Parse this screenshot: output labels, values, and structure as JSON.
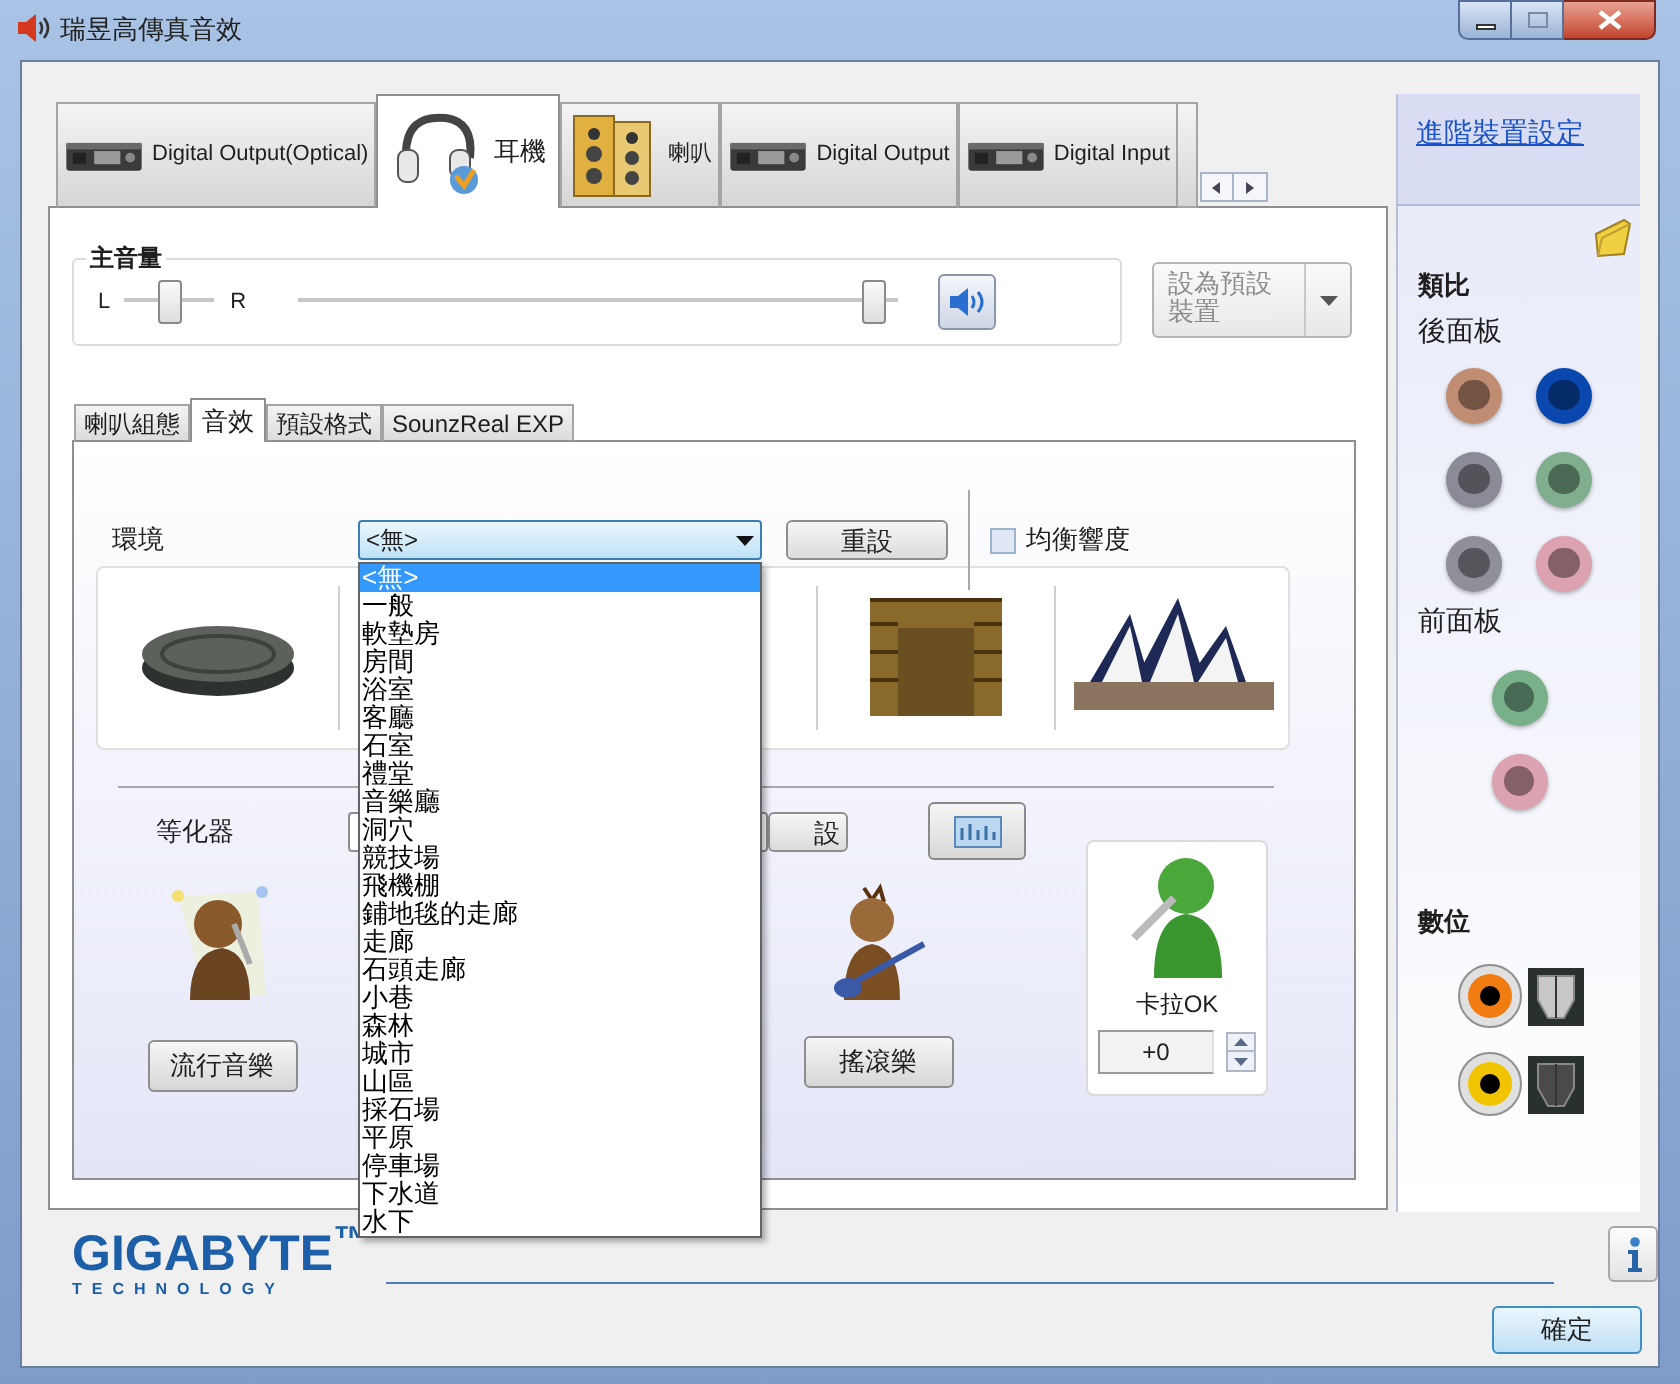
{
  "window": {
    "title": "瑞昱高傳真音效"
  },
  "device_tabs": [
    {
      "label": "Digital Output(Optical)",
      "kind": "digital",
      "selected": false
    },
    {
      "label": "耳機",
      "kind": "headphones",
      "selected": true
    },
    {
      "label": "喇叭",
      "kind": "speakers",
      "selected": false
    },
    {
      "label": "Digital Output",
      "kind": "digital",
      "selected": false
    },
    {
      "label": "Digital Input",
      "kind": "digital",
      "selected": false
    }
  ],
  "master_volume": {
    "label": "主音量",
    "left_label": "L",
    "right_label": "R",
    "balance": {
      "level": 0.5
    },
    "volume": {
      "level": 0.96
    }
  },
  "default_device_button": {
    "label": "設為預設裝置",
    "disabled": true
  },
  "effect_tabs": [
    {
      "label": "喇叭組態",
      "selected": false
    },
    {
      "label": "音效",
      "selected": true
    },
    {
      "label": "預設格式",
      "selected": false
    },
    {
      "label": "SounzReal EXP",
      "selected": false
    }
  ],
  "environment": {
    "label": "環境",
    "value": "<無>",
    "reset_button": "重設",
    "loudness": {
      "label": "均衡響度",
      "checked": false
    },
    "options": [
      {
        "label": "<無>",
        "selected": true
      },
      {
        "label": "一般",
        "selected": false
      },
      {
        "label": "軟墊房",
        "selected": false
      },
      {
        "label": "房間",
        "selected": false
      },
      {
        "label": "浴室",
        "selected": false
      },
      {
        "label": "客廳",
        "selected": false
      },
      {
        "label": "石室",
        "selected": false
      },
      {
        "label": "禮堂",
        "selected": false
      },
      {
        "label": "音樂廳",
        "selected": false
      },
      {
        "label": "洞穴",
        "selected": false
      },
      {
        "label": "競技場",
        "selected": false
      },
      {
        "label": "飛機棚",
        "selected": false
      },
      {
        "label": "鋪地毯的走廊",
        "selected": false
      },
      {
        "label": "走廊",
        "selected": false
      },
      {
        "label": "石頭走廊",
        "selected": false
      },
      {
        "label": "小巷",
        "selected": false
      },
      {
        "label": "森林",
        "selected": false
      },
      {
        "label": "城市",
        "selected": false
      },
      {
        "label": "山區",
        "selected": false
      },
      {
        "label": "採石場",
        "selected": false
      },
      {
        "label": "平原",
        "selected": false
      },
      {
        "label": "停車場",
        "selected": false
      },
      {
        "label": "下水道",
        "selected": false
      },
      {
        "label": "水下",
        "selected": false
      }
    ]
  },
  "equalizer": {
    "label": "等化器",
    "reset_button": "設",
    "presets": [
      {
        "label": "流行音樂",
        "kind": "pop"
      },
      {
        "label": "搖滾樂",
        "kind": "rock"
      }
    ]
  },
  "karaoke": {
    "label": "卡拉OK",
    "value": "+0"
  },
  "advanced_link": "進階裝置設定",
  "connectors": {
    "analog_label": "類比",
    "rear_label": "後面板",
    "rear_jacks": [
      {
        "color": "#c08c72"
      },
      {
        "color": "#0a48b0"
      },
      {
        "color": "#8a8b96"
      },
      {
        "color": "#7faf8e"
      },
      {
        "color": "#8e8f99"
      },
      {
        "color": "#dca2b0"
      }
    ],
    "front_label": "前面板",
    "front_jacks": [
      {
        "color": "#78b08a"
      },
      {
        "color": "#dca2b0"
      }
    ],
    "digital_label": "數位",
    "digital_jacks": [
      {
        "color": "#f07c12"
      },
      {
        "color": "#f0c400"
      }
    ]
  },
  "logo": {
    "name": "GIGABYTE$^{™}$",
    "tagline": "TECHNOLOGY"
  },
  "confirm_button": "確定"
}
